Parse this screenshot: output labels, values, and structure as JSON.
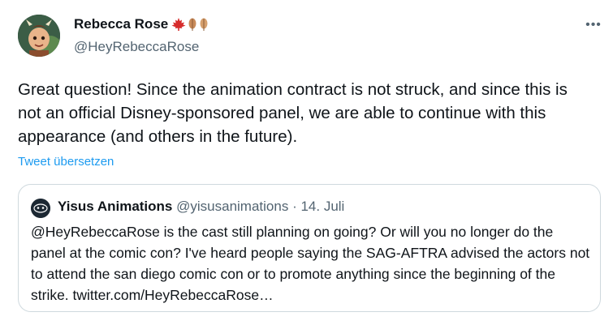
{
  "author": {
    "display_name": "Rebecca Rose",
    "handle": "@HeyRebeccaRose"
  },
  "tweet": {
    "text": "Great question! Since the animation contract is not struck, and since this is not an official Disney-sponsored panel, we are able to continue with this appearance (and others in the future).",
    "translate_label": "Tweet übersetzen",
    "more_icon": "•••"
  },
  "quoted_tweet": {
    "display_name": "Yisus Animations",
    "handle": "@yisusanimations",
    "separator": "·",
    "date": "14. Juli",
    "text": "@HeyRebeccaRose is the cast still planning on going? Or will you no longer do the panel at the comic con? I've heard people saying the SAG-AFTRA advised the actors not to attend the san diego comic con or to promote anything since the beginning of the strike. twitter.com/HeyRebeccaRose…"
  },
  "colors": {
    "link": "#1d9bf0",
    "secondary_text": "#536471",
    "border": "#cfd9de",
    "maple_leaf": "#d62b2b",
    "autumn_leaf": "#c98b5a"
  },
  "icons": [
    "avatar-image",
    "maple-leaf-icon",
    "autumn-leaf-icon",
    "more-icon",
    "quote-avatar-image"
  ]
}
